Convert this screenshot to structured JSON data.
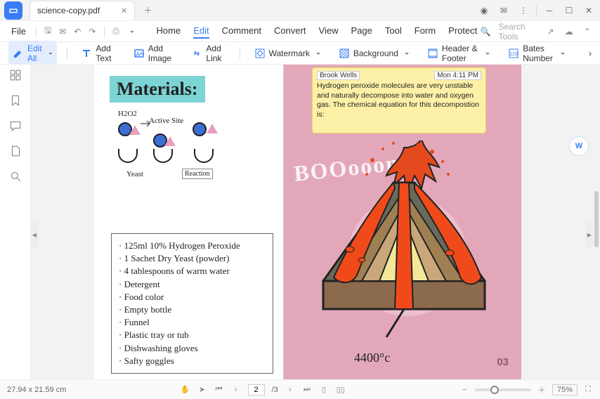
{
  "title": "science-copy.pdf",
  "menu": {
    "file": "File",
    "items": [
      "Home",
      "Edit",
      "Comment",
      "Convert",
      "View",
      "Page",
      "Tool",
      "Form",
      "Protect"
    ],
    "active": 1
  },
  "search": "Search Tools",
  "toolbar": {
    "editall": "Edit All",
    "addtext": "Add Text",
    "addimage": "Add Image",
    "addlink": "Add Link",
    "watermark": "Watermark",
    "background": "Background",
    "headerfooter": "Header & Footer",
    "bates": "Bates Number"
  },
  "doc": {
    "materials_title": "Materials:",
    "labels": {
      "h2o2": "H2O2",
      "active": "Active Site",
      "yeast": "Yeast",
      "reaction": "Reaction"
    },
    "materials": [
      "125ml 10% Hydrogen Peroxide",
      "1 Sachet Dry Yeast (powder)",
      "4 tablespoons of warm water",
      "Detergent",
      "Food color",
      "Empty bottle",
      "Funnel",
      "Plastic tray or tub",
      "Dishwashing gloves",
      "Safty goggles"
    ],
    "comment": {
      "user": "Brook Wells",
      "time": "Mon 4:11 PM",
      "body": "Hydrogen peroxide molecules are very unstable and naturally decompose into water and oxygen gas. The chemical equation for this decompostion is:"
    },
    "boom": "BOOooom!",
    "temp": "4400°c",
    "pagenum": "03"
  },
  "status": {
    "dims": "27.94 x 21.59 cm",
    "page": "2",
    "pages": "/3",
    "zoom": "75%"
  }
}
